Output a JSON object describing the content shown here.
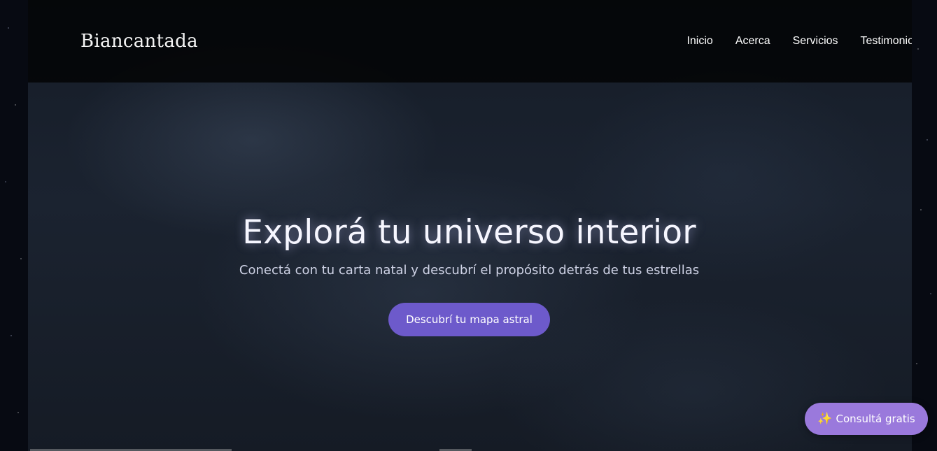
{
  "brand": {
    "name": "Biancantada"
  },
  "nav": {
    "items": [
      {
        "label": "Inicio"
      },
      {
        "label": "Acerca"
      },
      {
        "label": "Servicios"
      },
      {
        "label": "Testimonios"
      }
    ]
  },
  "hero": {
    "title": "Explorá tu universo interior",
    "subtitle": "Conectá con tu carta natal y descubrí el propósito detrás de tus estrellas",
    "cta_label": "Descubrí tu mapa astral"
  },
  "floating": {
    "icon": "sparkles-icon",
    "label": "Consultá gratis"
  },
  "colors": {
    "cta": "#6d5acb",
    "floating_button": "#9a79dc",
    "header_bg": "#030406"
  }
}
